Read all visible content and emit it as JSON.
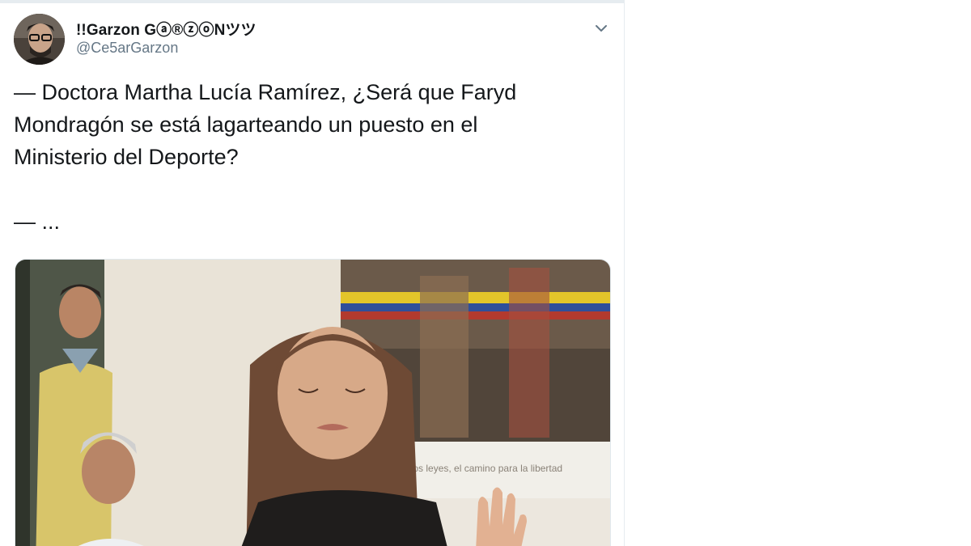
{
  "tweet": {
    "author": {
      "display_name": "!!Garzon Gⓐ®ⓩⓞNツツ",
      "handle": "@Ce5arGarzon"
    },
    "text_lines": [
      "— Doctora Martha Lucía Ramírez, ¿Será que Faryd",
      "Mondragón se está lagarteando un puesto en el",
      "Ministerio del Deporte?",
      "— ..."
    ],
    "menu_icon": "chevron-down-icon",
    "media": {
      "banner_text": "bros los leyes, el camino para la libertad"
    }
  },
  "colors": {
    "text_primary": "#14171a",
    "text_secondary": "#657786",
    "border": "#e6ecf0"
  }
}
